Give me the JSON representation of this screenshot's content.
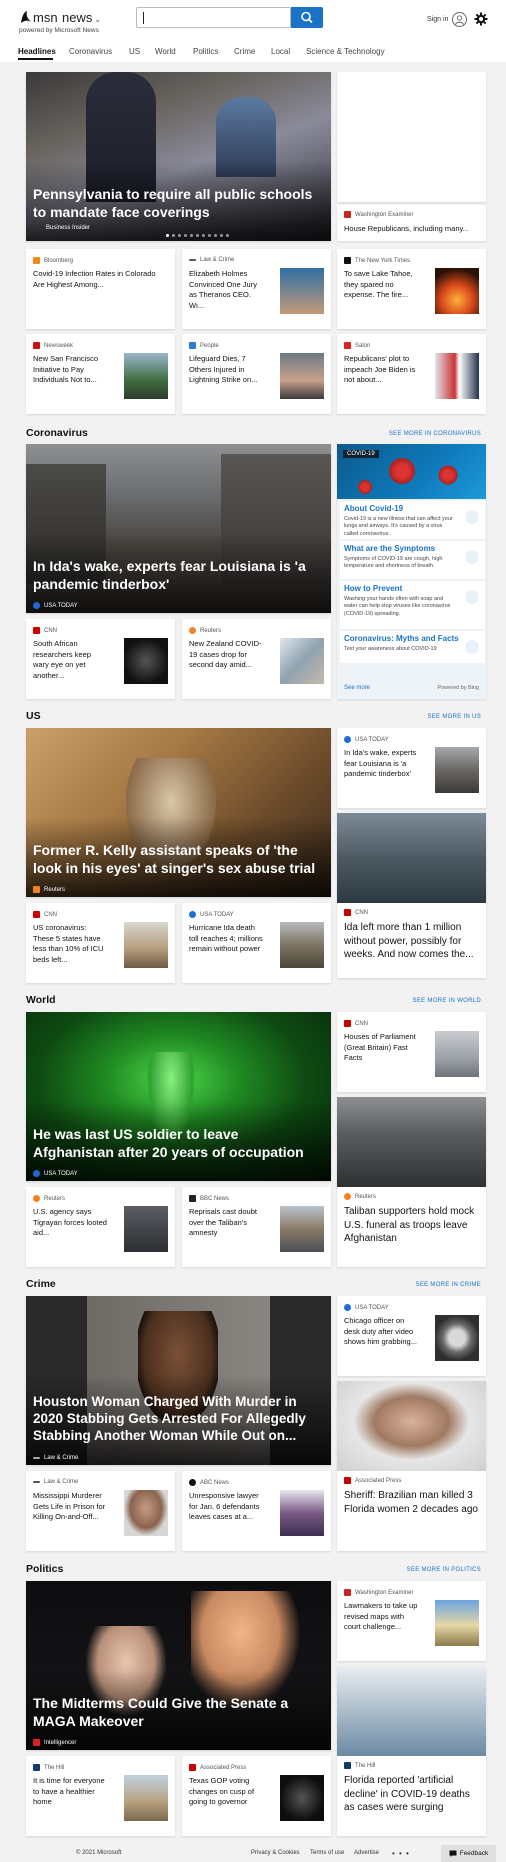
{
  "header": {
    "logo_text": "msn",
    "section_label": "news",
    "powered_by": "powered by Microsoft News",
    "search_placeholder": "",
    "signin_label": "Sign in"
  },
  "nav": {
    "items": [
      "Headlines",
      "Coronavirus",
      "US",
      "World",
      "Politics",
      "Crime",
      "Local",
      "Science & Technology"
    ],
    "active": "Headlines"
  },
  "top": {
    "hero": {
      "title": "Pennsylvania to require all public schools to mandate face coverings",
      "source": "Business Insider",
      "slide_count": 11,
      "active_slide": 1
    },
    "side_small": {
      "source": "Washington Examiner",
      "title": "House Republicans, including many..."
    },
    "cards": [
      {
        "source": "Bloomberg",
        "title": "Covid-19 Infection Rates in Colorado Are Highest Among..."
      },
      {
        "source": "Law & Crime",
        "title": "Elizabeth Holmes Convinced One Jury as Theranos CEO. Wi..."
      },
      {
        "source": "The New York Times",
        "title": "To save Lake Tahoe, they spared no expense. The fire..."
      },
      {
        "source": "Newsweek",
        "title": "New San Francisco Initiative to Pay Individuals Not to..."
      },
      {
        "source": "People",
        "title": "Lifeguard Dies, 7 Others Injured in Lightning Strike on..."
      },
      {
        "source": "Salon",
        "title": "Republicans' plot to impeach Joe Biden is not about..."
      }
    ]
  },
  "coronavirus": {
    "section_title": "Coronavirus",
    "see_more": "SEE MORE IN CORONAVIRUS",
    "hero": {
      "title": "In Ida's wake, experts fear Louisiana is 'a pandemic tinderbox'",
      "source": "USA TODAY"
    },
    "cards": [
      {
        "source": "CNN",
        "title": "South African researchers keep wary eye on yet another..."
      },
      {
        "source": "Reuters",
        "title": "New Zealand COVID-19 cases drop for second day amid..."
      }
    ],
    "info": {
      "tag": "COVID-19",
      "items": [
        {
          "title": "About Covid-19",
          "desc": "Covid-19 is a new illness that can affect your lungs and airways. It's caused by a virus called coronavirus."
        },
        {
          "title": "What are the Symptoms",
          "desc": "Symptoms of COVID-19 are cough, high temperature and shortness of breath."
        },
        {
          "title": "How to Prevent",
          "desc": "Washing your hands often with soap and water can help stop viruses like coronavirus (COVID-19) spreading."
        },
        {
          "title": "Coronavirus: Myths and Facts",
          "desc": "Test your awareness about COVID-19"
        }
      ],
      "see_more": "See more",
      "powered": "Powered by Bing"
    }
  },
  "us": {
    "section_title": "US",
    "see_more": "SEE MORE IN US",
    "hero": {
      "title": "Former R. Kelly assistant speaks of 'the look in his eyes' at singer's sex abuse trial",
      "source": "Reuters"
    },
    "side_small": {
      "source": "USA TODAY",
      "title": "In Ida's wake, experts fear Louisiana is 'a pandemic tinderbox'"
    },
    "side_tall": {
      "source": "CNN",
      "title": "Ida left more than 1 million without power, possibly for weeks. And now comes the..."
    },
    "cards": [
      {
        "source": "CNN",
        "title": "US coronavirus: These 5 states have less than 10% of ICU beds left..."
      },
      {
        "source": "USA TODAY",
        "title": "Hurricane Ida death toll reaches 4; millions remain without power"
      }
    ]
  },
  "world": {
    "section_title": "World",
    "see_more": "SEE MORE IN WORLD",
    "hero": {
      "title": "He was last US soldier to leave Afghanistan after 20 years of occupation",
      "source": "USA TODAY"
    },
    "side_small": {
      "source": "CNN",
      "title": "Houses of Parliament (Great Britain) Fast Facts"
    },
    "side_tall": {
      "source": "Reuters",
      "title": "Taliban supporters hold mock U.S. funeral as troops leave Afghanistan"
    },
    "cards": [
      {
        "source": "Reuters",
        "title": "U.S. agency says Tigrayan forces looted aid..."
      },
      {
        "source": "BBC News",
        "title": "Reprisals cast doubt over the Taliban's amnesty"
      }
    ]
  },
  "crime": {
    "section_title": "Crime",
    "see_more": "SEE MORE IN CRIME",
    "hero": {
      "title": "Houston Woman Charged With Murder in 2020 Stabbing Gets Arrested For Allegedly Stabbing Another Woman While Out on...",
      "source": "Law & Crime"
    },
    "side_small": {
      "source": "USA TODAY",
      "title": "Chicago officer on desk duty after video shows him grabbing..."
    },
    "side_tall": {
      "source": "Associated Press",
      "title": "Sheriff: Brazilian man killed 3 Florida women 2 decades ago"
    },
    "cards": [
      {
        "source": "Law & Crime",
        "title": "Mississippi Murderer Gets Life in Prison for Killing On-and-Off..."
      },
      {
        "source": "ABC News",
        "title": "Unresponsive lawyer for Jan. 6 defendants leaves cases at a..."
      }
    ]
  },
  "politics": {
    "section_title": "Politics",
    "see_more": "SEE MORE IN POLITICS",
    "hero": {
      "title": "The Midterms Could Give the Senate a MAGA Makeover",
      "source": "Intelligencer"
    },
    "side_small": {
      "source": "Washington Examiner",
      "title": "Lawmakers to take up revised maps with court challenge..."
    },
    "side_tall": {
      "source": "The Hill",
      "title": "Florida reported 'artificial decline' in COVID-19 deaths as cases were surging"
    },
    "cards": [
      {
        "source": "The Hill",
        "title": "It is time for everyone to have a healthier home"
      },
      {
        "source": "Associated Press",
        "title": "Texas GOP voting changes on cusp of going to governor"
      }
    ]
  },
  "footer": {
    "copyright": "© 2021 Microsoft",
    "links": [
      "Privacy & Cookies",
      "Terms of use",
      "Advertise"
    ],
    "more": "• • •",
    "feedback": "Feedback"
  },
  "colors": {
    "accent": "#1a73c8",
    "background": "#f2f2f2"
  }
}
